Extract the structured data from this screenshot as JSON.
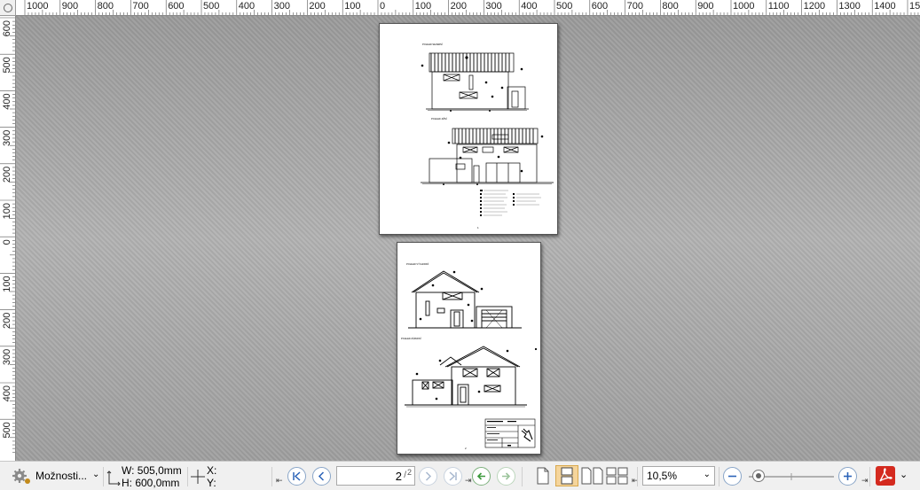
{
  "rulers": {
    "horizontal_labels": [
      "1000",
      "900",
      "800",
      "700",
      "600",
      "500",
      "400",
      "300",
      "200",
      "100",
      "0",
      "100",
      "200",
      "300",
      "400",
      "500",
      "600",
      "700",
      "800",
      "900",
      "1000",
      "1100",
      "1200",
      "1300",
      "1400",
      "15"
    ],
    "vertical_labels": [
      "600",
      "500",
      "400",
      "300",
      "200",
      "100",
      "0",
      "100",
      "200",
      "300",
      "400",
      "500"
    ]
  },
  "statusbar": {
    "options_label": "Možnosti...",
    "width_label": "W: 505,0mm",
    "height_label": "H: 600,0mm",
    "x_label": "X:",
    "y_label": "Y:",
    "page_field": "2/2",
    "page_value": "2",
    "page_total": "2",
    "zoom_value": "10,5%",
    "zoom_slider_position_fraction": 0.05
  },
  "pages": {
    "page1": {
      "title1": "POHLED SEVERNÍ",
      "title2": "POHLED JIŽNÍ",
      "page_number": "1"
    },
    "page2": {
      "title1": "POHLED VÝCHODNÍ",
      "title2": "POHLED ZÁPADNÍ",
      "page_number": "2"
    }
  },
  "colors": {
    "accent_blue": "#2b63b8",
    "green_nav": "#3c9a3c",
    "pdf_red": "#d42a1f",
    "selected_view": "#f5d59c"
  }
}
